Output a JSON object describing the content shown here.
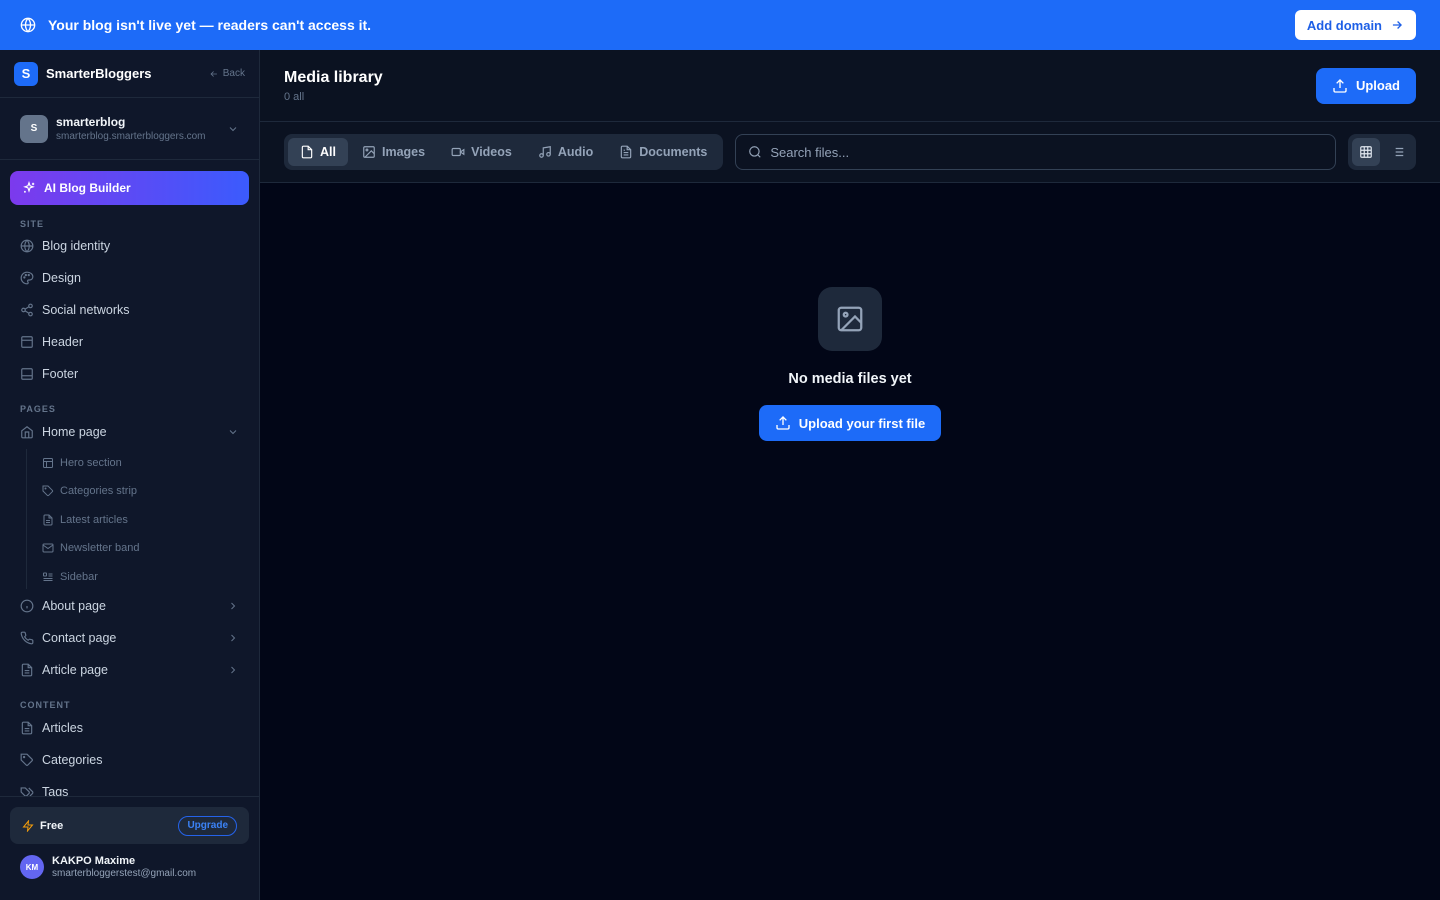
{
  "banner": {
    "message": "Your blog isn't live yet — readers can't access it.",
    "action_label": "Add domain"
  },
  "brand": {
    "logo_letter": "S",
    "name": "SmarterBloggers",
    "back_label": "Back"
  },
  "site": {
    "avatar_letter": "S",
    "name": "smarterblog",
    "domain": "smarterblog.smarterbloggers.com"
  },
  "ai_button": {
    "label": "AI Blog Builder"
  },
  "sidebar": {
    "sections": {
      "site": "SITE",
      "pages": "PAGES",
      "content": "CONTENT"
    },
    "site_items": [
      {
        "label": "Blog identity",
        "icon": "globe-icon"
      },
      {
        "label": "Design",
        "icon": "palette-icon"
      },
      {
        "label": "Social networks",
        "icon": "share-icon"
      },
      {
        "label": "Header",
        "icon": "layout-icon"
      },
      {
        "label": "Footer",
        "icon": "layout-icon"
      }
    ],
    "pages": [
      {
        "label": "Home page",
        "icon": "home-icon",
        "expanded": true
      },
      {
        "label": "About page",
        "icon": "info-icon"
      },
      {
        "label": "Contact page",
        "icon": "phone-icon"
      },
      {
        "label": "Article page",
        "icon": "file-icon"
      }
    ],
    "home_subitems": [
      {
        "label": "Hero section",
        "icon": "layout-icon"
      },
      {
        "label": "Categories strip",
        "icon": "tag-icon"
      },
      {
        "label": "Latest articles",
        "icon": "file-icon"
      },
      {
        "label": "Newsletter band",
        "icon": "mail-icon"
      },
      {
        "label": "Sidebar",
        "icon": "list-icon"
      }
    ],
    "content_items": [
      {
        "label": "Articles",
        "icon": "file-icon"
      },
      {
        "label": "Categories",
        "icon": "tag-icon"
      },
      {
        "label": "Tags",
        "icon": "tags-icon"
      }
    ]
  },
  "plan": {
    "name": "Free",
    "upgrade_label": "Upgrade"
  },
  "user": {
    "initials": "KM",
    "name": "KAKPO Maxime",
    "email": "smarterbloggerstest@gmail.com"
  },
  "main": {
    "title": "Media library",
    "count": "0 all",
    "upload_label": "Upload",
    "filters": [
      {
        "label": "All",
        "icon": "file-icon",
        "active": true
      },
      {
        "label": "Images",
        "icon": "image-icon"
      },
      {
        "label": "Videos",
        "icon": "video-icon"
      },
      {
        "label": "Audio",
        "icon": "music-icon"
      },
      {
        "label": "Documents",
        "icon": "document-icon"
      }
    ],
    "search_placeholder": "Search files...",
    "view_mode": "grid",
    "empty_title": "No media files yet",
    "empty_button": "Upload your first file"
  },
  "colors": {
    "accent": "#1d6bf8",
    "background": "#020617",
    "panel": "#0f172a"
  }
}
